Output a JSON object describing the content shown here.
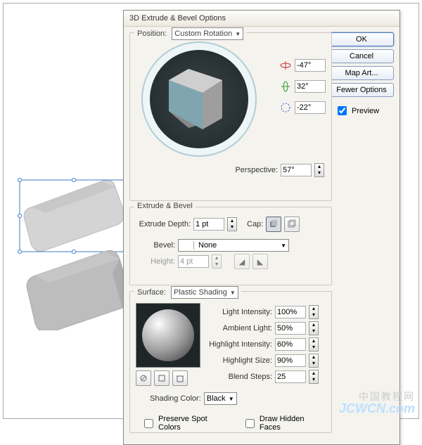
{
  "dialog": {
    "title": "3D Extrude & Bevel Options",
    "position_label": "Position:",
    "position_value": "Custom Rotation",
    "axis_x": "-47°",
    "axis_y": "32°",
    "axis_z": "-22°",
    "perspective_label": "Perspective:",
    "perspective_value": "57°"
  },
  "buttons": {
    "ok": "OK",
    "cancel": "Cancel",
    "map_art": "Map Art...",
    "fewer": "Fewer Options",
    "preview": "Preview"
  },
  "extrude": {
    "section": "Extrude & Bevel",
    "depth_label": "Extrude Depth:",
    "depth_value": "1 pt",
    "cap_label": "Cap:",
    "bevel_label": "Bevel:",
    "bevel_value": "None",
    "height_label": "Height:",
    "height_value": "4 pt"
  },
  "surface": {
    "label": "Surface:",
    "value": "Plastic Shading",
    "light_intensity_label": "Light Intensity:",
    "light_intensity_value": "100%",
    "ambient_label": "Ambient Light:",
    "ambient_value": "50%",
    "hi_intensity_label": "Highlight Intensity:",
    "hi_intensity_value": "60%",
    "hi_size_label": "Highlight Size:",
    "hi_size_value": "90%",
    "blend_label": "Blend Steps:",
    "blend_value": "25",
    "shading_color_label": "Shading Color:",
    "shading_color_value": "Black",
    "preserve_spot": "Preserve Spot Colors",
    "draw_hidden": "Draw Hidden Faces"
  },
  "watermark": {
    "zh": "中国教程网",
    "url": "JCWCN.com"
  }
}
